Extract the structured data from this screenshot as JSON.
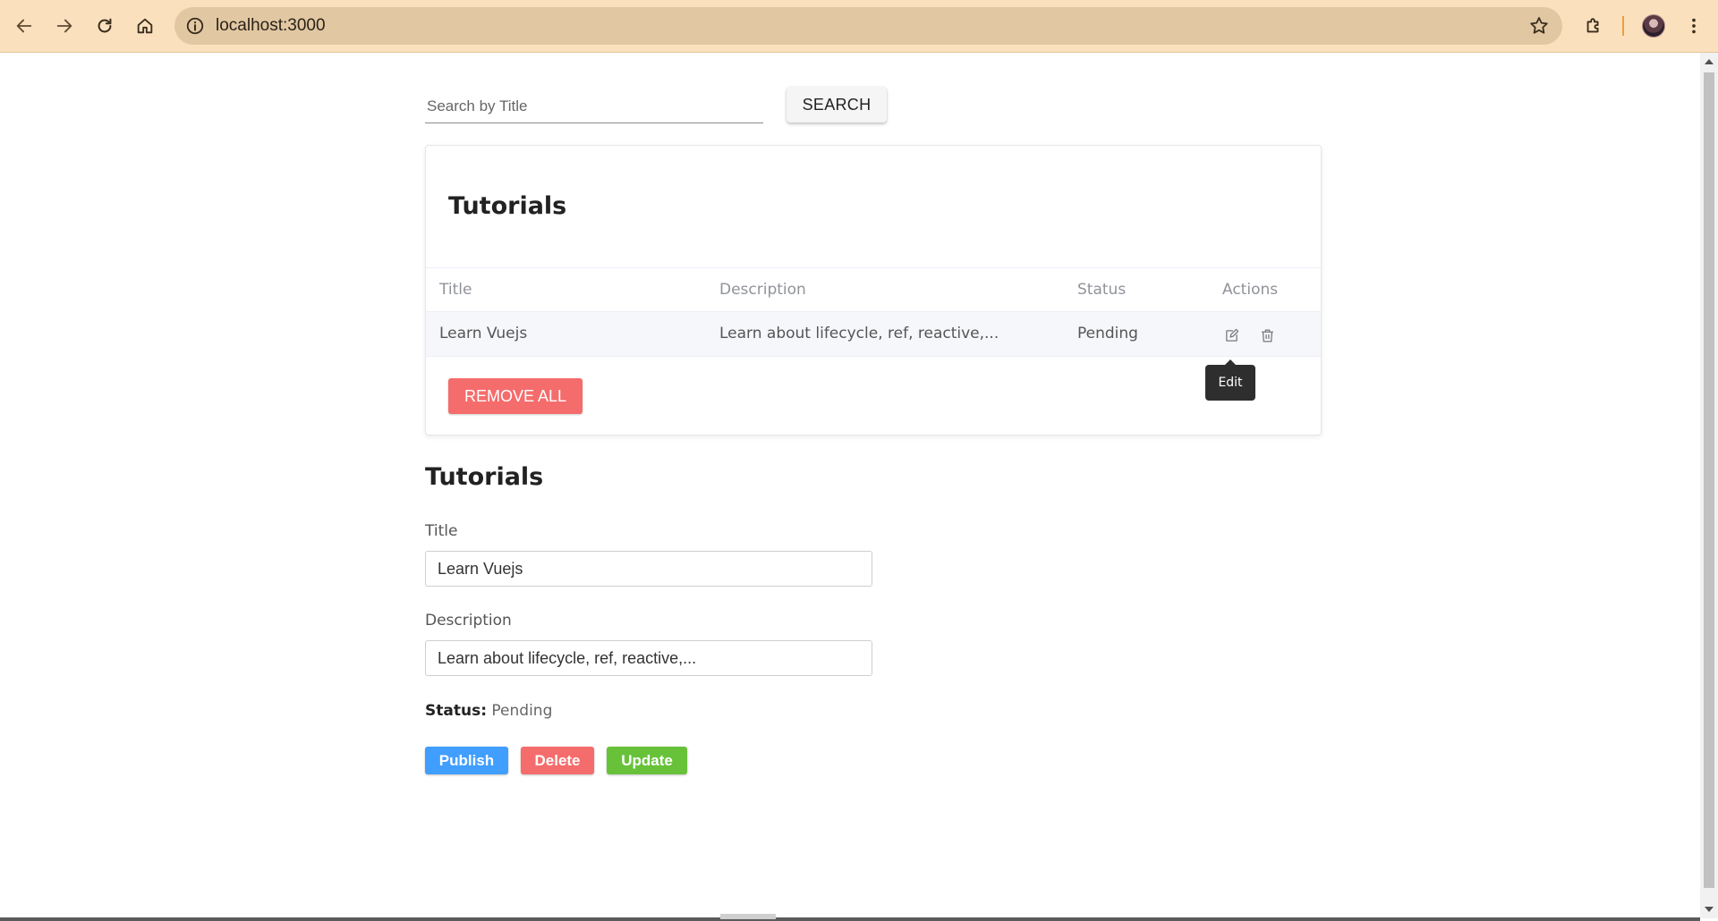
{
  "browser": {
    "url": "localhost:3000",
    "icons": {
      "back": "back-arrow-icon",
      "forward": "forward-arrow-icon",
      "reload": "reload-icon",
      "home": "home-icon",
      "info": "info-icon",
      "bookmark": "star-icon",
      "extensions": "puzzle-icon",
      "profile": "avatar",
      "menu": "kebab-menu-icon"
    }
  },
  "search": {
    "placeholder": "Search by Title",
    "button_label": "SEARCH"
  },
  "list": {
    "title": "Tutorials",
    "columns": [
      "Title",
      "Description",
      "Status",
      "Actions"
    ],
    "rows": [
      {
        "title": "Learn Vuejs",
        "description": "Learn about lifecycle, ref, reactive,...",
        "status": "Pending"
      }
    ],
    "tooltip": "Edit",
    "remove_all_label": "REMOVE ALL"
  },
  "edit_form": {
    "title": "Tutorials",
    "title_label": "Title",
    "title_value": "Learn Vuejs",
    "description_label": "Description",
    "description_value": "Learn about lifecycle, ref, reactive,...",
    "status_label": "Status:",
    "status_value": "Pending",
    "publish_label": "Publish",
    "delete_label": "Delete",
    "update_label": "Update"
  },
  "colors": {
    "chrome_bg": "#fbe0bd",
    "danger": "#f56c6c",
    "primary": "#409eff",
    "success": "#67c23a"
  }
}
